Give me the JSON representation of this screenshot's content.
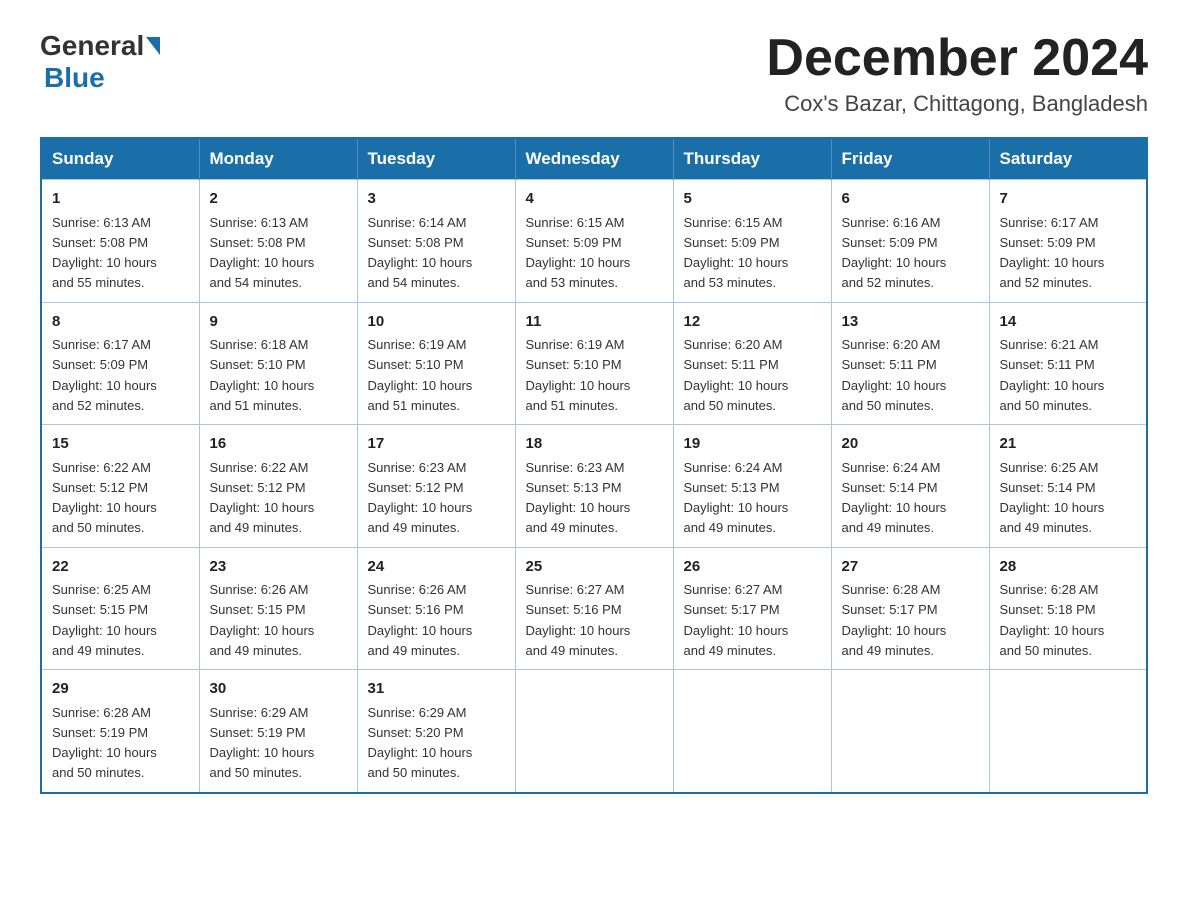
{
  "header": {
    "logo": {
      "general": "General",
      "blue": "Blue"
    },
    "title": "December 2024",
    "location": "Cox's Bazar, Chittagong, Bangladesh"
  },
  "calendar": {
    "weekdays": [
      "Sunday",
      "Monday",
      "Tuesday",
      "Wednesday",
      "Thursday",
      "Friday",
      "Saturday"
    ],
    "weeks": [
      [
        {
          "day": "1",
          "sunrise": "6:13 AM",
          "sunset": "5:08 PM",
          "daylight": "10 hours and 55 minutes."
        },
        {
          "day": "2",
          "sunrise": "6:13 AM",
          "sunset": "5:08 PM",
          "daylight": "10 hours and 54 minutes."
        },
        {
          "day": "3",
          "sunrise": "6:14 AM",
          "sunset": "5:08 PM",
          "daylight": "10 hours and 54 minutes."
        },
        {
          "day": "4",
          "sunrise": "6:15 AM",
          "sunset": "5:09 PM",
          "daylight": "10 hours and 53 minutes."
        },
        {
          "day": "5",
          "sunrise": "6:15 AM",
          "sunset": "5:09 PM",
          "daylight": "10 hours and 53 minutes."
        },
        {
          "day": "6",
          "sunrise": "6:16 AM",
          "sunset": "5:09 PM",
          "daylight": "10 hours and 52 minutes."
        },
        {
          "day": "7",
          "sunrise": "6:17 AM",
          "sunset": "5:09 PM",
          "daylight": "10 hours and 52 minutes."
        }
      ],
      [
        {
          "day": "8",
          "sunrise": "6:17 AM",
          "sunset": "5:09 PM",
          "daylight": "10 hours and 52 minutes."
        },
        {
          "day": "9",
          "sunrise": "6:18 AM",
          "sunset": "5:10 PM",
          "daylight": "10 hours and 51 minutes."
        },
        {
          "day": "10",
          "sunrise": "6:19 AM",
          "sunset": "5:10 PM",
          "daylight": "10 hours and 51 minutes."
        },
        {
          "day": "11",
          "sunrise": "6:19 AM",
          "sunset": "5:10 PM",
          "daylight": "10 hours and 51 minutes."
        },
        {
          "day": "12",
          "sunrise": "6:20 AM",
          "sunset": "5:11 PM",
          "daylight": "10 hours and 50 minutes."
        },
        {
          "day": "13",
          "sunrise": "6:20 AM",
          "sunset": "5:11 PM",
          "daylight": "10 hours and 50 minutes."
        },
        {
          "day": "14",
          "sunrise": "6:21 AM",
          "sunset": "5:11 PM",
          "daylight": "10 hours and 50 minutes."
        }
      ],
      [
        {
          "day": "15",
          "sunrise": "6:22 AM",
          "sunset": "5:12 PM",
          "daylight": "10 hours and 50 minutes."
        },
        {
          "day": "16",
          "sunrise": "6:22 AM",
          "sunset": "5:12 PM",
          "daylight": "10 hours and 49 minutes."
        },
        {
          "day": "17",
          "sunrise": "6:23 AM",
          "sunset": "5:12 PM",
          "daylight": "10 hours and 49 minutes."
        },
        {
          "day": "18",
          "sunrise": "6:23 AM",
          "sunset": "5:13 PM",
          "daylight": "10 hours and 49 minutes."
        },
        {
          "day": "19",
          "sunrise": "6:24 AM",
          "sunset": "5:13 PM",
          "daylight": "10 hours and 49 minutes."
        },
        {
          "day": "20",
          "sunrise": "6:24 AM",
          "sunset": "5:14 PM",
          "daylight": "10 hours and 49 minutes."
        },
        {
          "day": "21",
          "sunrise": "6:25 AM",
          "sunset": "5:14 PM",
          "daylight": "10 hours and 49 minutes."
        }
      ],
      [
        {
          "day": "22",
          "sunrise": "6:25 AM",
          "sunset": "5:15 PM",
          "daylight": "10 hours and 49 minutes."
        },
        {
          "day": "23",
          "sunrise": "6:26 AM",
          "sunset": "5:15 PM",
          "daylight": "10 hours and 49 minutes."
        },
        {
          "day": "24",
          "sunrise": "6:26 AM",
          "sunset": "5:16 PM",
          "daylight": "10 hours and 49 minutes."
        },
        {
          "day": "25",
          "sunrise": "6:27 AM",
          "sunset": "5:16 PM",
          "daylight": "10 hours and 49 minutes."
        },
        {
          "day": "26",
          "sunrise": "6:27 AM",
          "sunset": "5:17 PM",
          "daylight": "10 hours and 49 minutes."
        },
        {
          "day": "27",
          "sunrise": "6:28 AM",
          "sunset": "5:17 PM",
          "daylight": "10 hours and 49 minutes."
        },
        {
          "day": "28",
          "sunrise": "6:28 AM",
          "sunset": "5:18 PM",
          "daylight": "10 hours and 50 minutes."
        }
      ],
      [
        {
          "day": "29",
          "sunrise": "6:28 AM",
          "sunset": "5:19 PM",
          "daylight": "10 hours and 50 minutes."
        },
        {
          "day": "30",
          "sunrise": "6:29 AM",
          "sunset": "5:19 PM",
          "daylight": "10 hours and 50 minutes."
        },
        {
          "day": "31",
          "sunrise": "6:29 AM",
          "sunset": "5:20 PM",
          "daylight": "10 hours and 50 minutes."
        },
        null,
        null,
        null,
        null
      ]
    ],
    "labels": {
      "sunrise": "Sunrise:",
      "sunset": "Sunset:",
      "daylight": "Daylight:"
    }
  }
}
